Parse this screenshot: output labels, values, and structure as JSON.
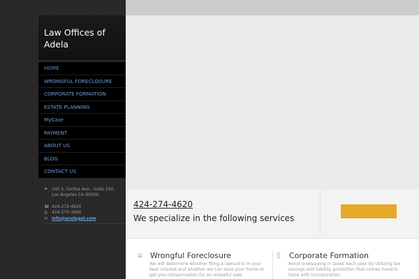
{
  "site": {
    "title_line1": "Law Offices of",
    "title_line2": "Adela"
  },
  "nav": {
    "items": [
      {
        "label": "HOME"
      },
      {
        "label": "WRONGFUL FORECLOSURE"
      },
      {
        "label": "CORPORATE FORMATION"
      },
      {
        "label": "ESTATE PLANNING"
      },
      {
        "label": "MyCase"
      },
      {
        "label": "PAYMENT"
      },
      {
        "label": "ABOUT US"
      },
      {
        "label": "BLOG"
      },
      {
        "label": "CONTACT US"
      }
    ]
  },
  "contact": {
    "address_line1": "145 S. Fairfax Ave., Suite 200,",
    "address_line2": "Los Angeles CA 90036",
    "phone": "424-274-4620",
    "fax": "424-270-1680",
    "email": "info@azulegal.com"
  },
  "callout": {
    "phone": "424-274-4620",
    "text": "We specialize in the following services"
  },
  "services": [
    {
      "title": "Wrongful Foreclosure",
      "desc_line1": "We will determine whether filing a lawsuit is in your",
      "desc_line2": "best interest and whether we can save your home or",
      "desc_line3": "get you compensation for an unlawful sale.",
      "icon": "home-icon"
    },
    {
      "title": "Corporate Formation",
      "desc_line1": "Avoid overpaying in taxes each year by utilizing tax",
      "desc_line2": "savings and liability protection that comes hand in",
      "desc_line3": "hand with incorporation.",
      "icon": "building-icon"
    }
  ],
  "colors": {
    "accent": "#e6a827",
    "link": "#6d9fd8"
  }
}
